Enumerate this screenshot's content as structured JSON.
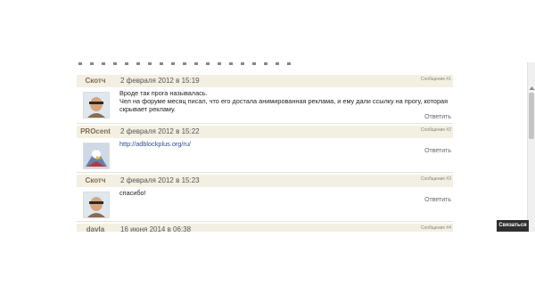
{
  "posts": [
    {
      "author": "Скотч",
      "date": "2 февраля 2012 в 15:19",
      "msgnum": "Сообщение #1",
      "lines": [
        "Вроде так прога называлась.",
        "Чел на форуме месяц писал, что его достала анимированная реклама, и ему дали ссылку на прогу, которая",
        "скрывает рекламу."
      ],
      "reply": "Ответить"
    },
    {
      "author": "PROcent",
      "date": "2 февраля 2012 в 15:22",
      "msgnum": "Сообщение #2",
      "link": "http://adblockplus.org/ru/",
      "reply": "Ответить"
    },
    {
      "author": "Скотч",
      "date": "2 февраля 2012 в 15:23",
      "msgnum": "Сообщение #3",
      "text": "спасибо!",
      "reply": "Ответить"
    },
    {
      "author": "davla",
      "date": "16 июня 2014 в 06:38",
      "msgnum": "Сообщение #4"
    }
  ],
  "contact_button": "Связаться"
}
